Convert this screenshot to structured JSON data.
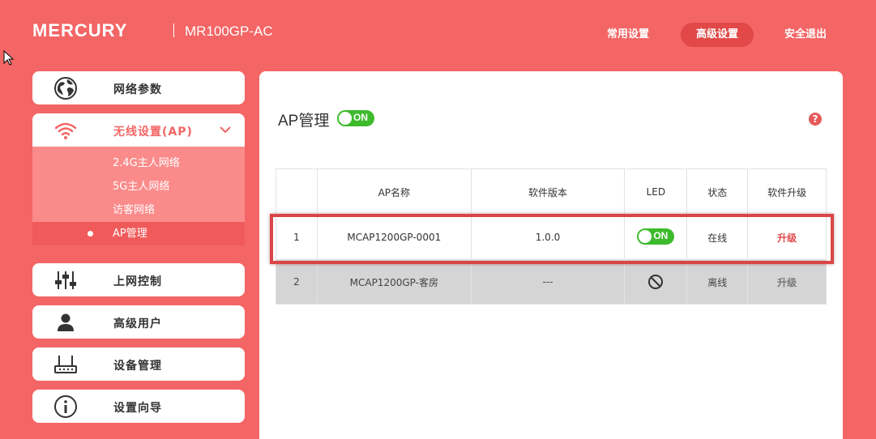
{
  "header": {
    "brand": "MERCURY",
    "model": "MR100GP-AC",
    "nav": {
      "common": "常用设置",
      "advanced": "高级设置",
      "exit": "安全退出"
    }
  },
  "sidebar": {
    "network": "网络参数",
    "wireless": "无线设置(AP)",
    "submenu": {
      "host24": "2.4G主人网络",
      "host5": "5G主人网络",
      "guest": "访客网络",
      "ap": "AP管理"
    },
    "access_control": "上网控制",
    "advanced_user": "高级用户",
    "device_mgmt": "设备管理",
    "wizard": "设置向导"
  },
  "main": {
    "title": "AP管理",
    "toggle": "ON",
    "help": "?",
    "columns": {
      "index": "",
      "name": "AP名称",
      "version": "软件版本",
      "led": "LED",
      "status": "状态",
      "upgrade": "软件升级"
    },
    "rows": [
      {
        "index": "1",
        "name": "MCAP1200GP-0001",
        "version": "1.0.0",
        "led": "ON",
        "status": "在线",
        "upgrade": "升级"
      },
      {
        "index": "2",
        "name": "MCAP1200GP-客房",
        "version": "---",
        "led": "",
        "status": "离线",
        "upgrade": "升级"
      }
    ]
  },
  "colors": {
    "background": "#f46565",
    "accent": "#e24848",
    "toggle_on": "#3dbb2c"
  }
}
